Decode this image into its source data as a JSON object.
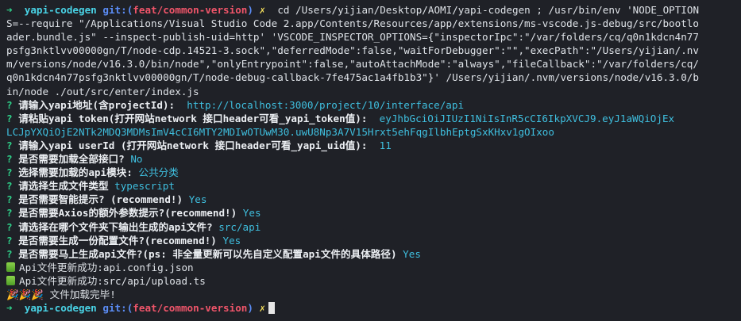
{
  "prompt": {
    "arrow": "➜",
    "dir": "yapi-codegen",
    "git_label": "git:",
    "paren_open": "(",
    "branch": "feat/common-version",
    "paren_close": ")",
    "dirty_mark": "✗"
  },
  "command_lines": [
    "cd /Users/yijian/Desktop/AOMI/yapi-codegen ; /usr/bin/env 'NODE_OPTION",
    "S=--require \"/Applications/Visual Studio Code 2.app/Contents/Resources/app/extensions/ms-vscode.js-debug/src/bootlo",
    "ader.bundle.js\" --inspect-publish-uid=http' 'VSCODE_INSPECTOR_OPTIONS={\"inspectorIpc\":\"/var/folders/cq/q0n1kdcn4n77",
    "psfg3nktlvv00000gn/T/node-cdp.14521-3.sock\",\"deferredMode\":false,\"waitForDebugger\":\"\",\"execPath\":\"/Users/yijian/.nv",
    "m/versions/node/v16.3.0/bin/node\",\"onlyEntrypoint\":false,\"autoAttachMode\":\"always\",\"fileCallback\":\"/var/folders/cq/",
    "q0n1kdcn4n77psfg3nktlvv00000gn/T/node-debug-callback-7fe475ac1a4fb1b3\"}' /Users/yijian/.nvm/versions/node/v16.3.0/b",
    "in/node ./out/src/enter/index.js"
  ],
  "qa": [
    {
      "mark": "?",
      "question": "请输入yapi地址(含projectId):",
      "answer": "http://localhost:3000/project/10/interface/api"
    },
    {
      "mark": "?",
      "question": "请粘贴yapi token(打开网站network 接口header可看_yapi_token值):",
      "answer": "eyJhbGciOiJIUzI1NiIsInR5cCI6IkpXVCJ9.eyJ1aWQiOjEx"
    },
    {
      "mark": "",
      "question": "",
      "answer": "LCJpYXQiOjE2NTk2MDQ3MDMsImV4cCI6MTY2MDIwOTUwM30.uwU8Np3A7V15Hrxt5ehFqgIlbhEptgSxKHxv1gOIxoo"
    },
    {
      "mark": "?",
      "question": "请输入yapi userId (打开网站network 接口header可看_yapi_uid值):",
      "answer": "11"
    },
    {
      "mark": "?",
      "question": "是否需要加载全部接口?",
      "answer": "No"
    },
    {
      "mark": "?",
      "question": "选择需要加载的api模块:",
      "answer": "公共分类"
    },
    {
      "mark": "?",
      "question": "请选择生成文件类型",
      "answer": "typescript"
    },
    {
      "mark": "?",
      "question": "是否需要智能提示? (recommend!)",
      "answer": "Yes"
    },
    {
      "mark": "?",
      "question": "是否需要Axios的额外参数提示?(recommend!)",
      "answer": "Yes"
    },
    {
      "mark": "?",
      "question": "请选择在哪个文件夹下输出生成的api文件?",
      "answer": "src/api"
    },
    {
      "mark": "?",
      "question": "是否需要生成一份配置文件?(recommend!)",
      "answer": "Yes"
    },
    {
      "mark": "?",
      "question": "是否需要马上生成api文件?(ps: 非全量更新可以先自定义配置api文件的具体路径)",
      "answer": "Yes"
    }
  ],
  "success_lines": [
    {
      "icon": "green-check-square-icon",
      "text": "Api文件更新成功:api.config.json"
    },
    {
      "icon": "green-check-square-icon",
      "text": "Api文件更新成功:src/api/upload.ts"
    }
  ],
  "done_line": {
    "icon": "party-popper-icon",
    "glyphs": "🎉🎉🎉",
    "text": "文件加载完毕!"
  },
  "colors": {
    "background": "#1f2127",
    "arrow": "#2fd18a",
    "dir": "#49d3e6",
    "git": "#5b8cf5",
    "branch": "#f0556a",
    "dirty": "#f2dc5b",
    "answer": "#3fbfdf"
  }
}
